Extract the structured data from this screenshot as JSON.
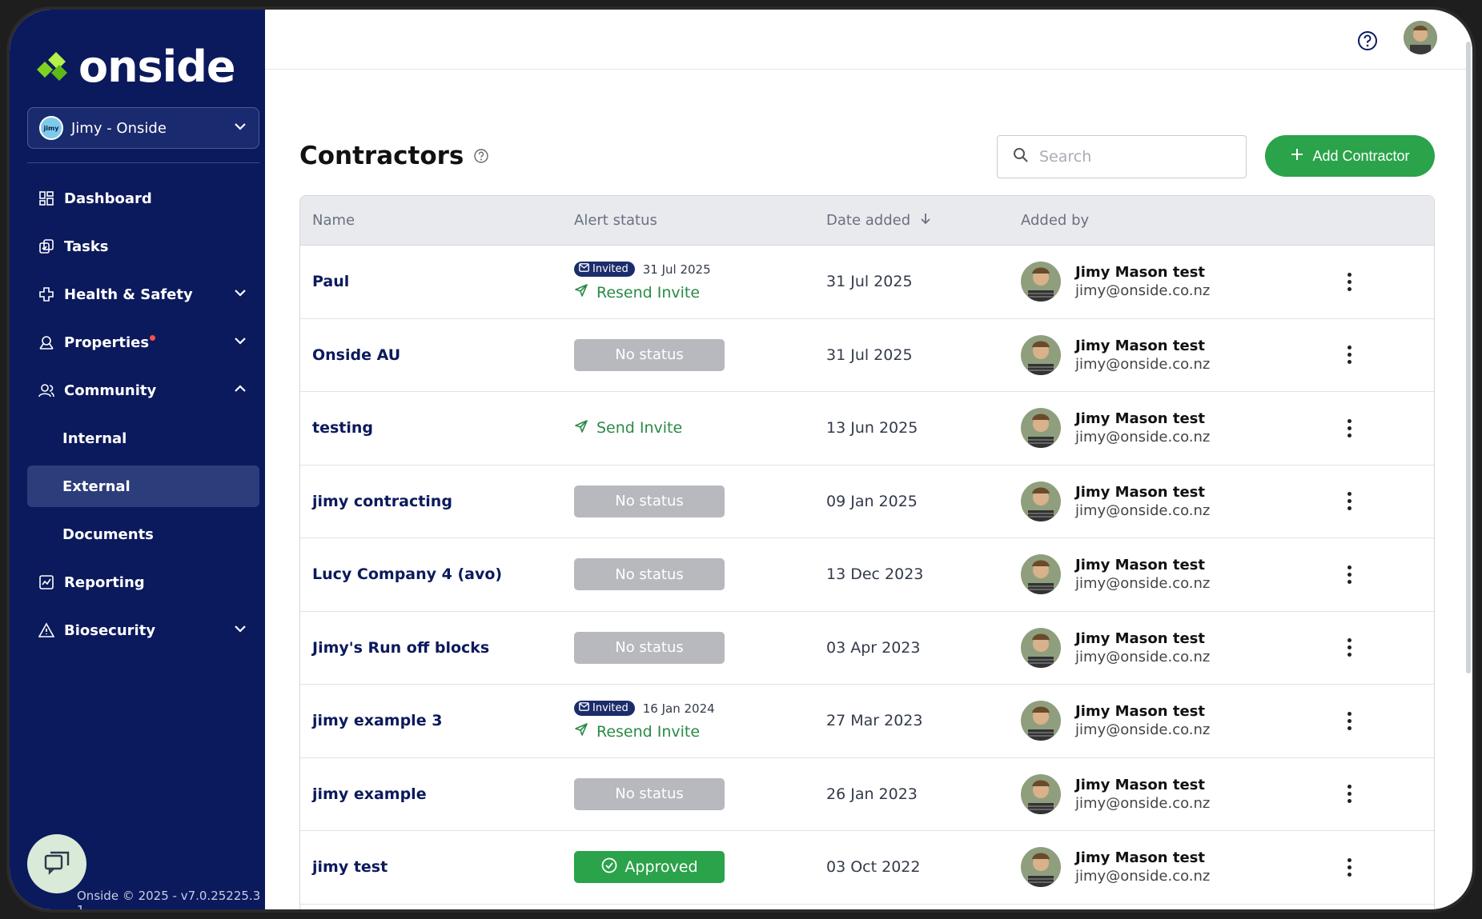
{
  "brand": {
    "name": "onside",
    "accent": "#7ed321"
  },
  "org_selector": {
    "label": "Jimy - Onside"
  },
  "nav": {
    "dashboard": "Dashboard",
    "tasks": "Tasks",
    "health_safety": "Health & Safety",
    "properties": "Properties",
    "community": "Community",
    "internal": "Internal",
    "external": "External",
    "documents": "Documents",
    "reporting": "Reporting",
    "biosecurity": "Biosecurity"
  },
  "footer": {
    "version": "Onside © 2025 - v7.0.25225.3 1"
  },
  "page": {
    "title": "Contractors"
  },
  "search": {
    "placeholder": "Search"
  },
  "actions": {
    "add_contractor": "Add Contractor"
  },
  "table": {
    "columns": {
      "name": "Name",
      "alert_status": "Alert status",
      "date_added": "Date added",
      "added_by": "Added by"
    },
    "rows": [
      {
        "name": "Paul",
        "status_type": "invited",
        "invited_label": "Invited",
        "invited_date": "31 Jul 2025",
        "action": "Resend Invite",
        "date": "31 Jul 2025",
        "by_name": "Jimy Mason test",
        "by_email": "jimy@onside.co.nz"
      },
      {
        "name": "Onside AU",
        "status_type": "none",
        "status": "No status",
        "date": "31 Jul 2025",
        "by_name": "Jimy Mason test",
        "by_email": "jimy@onside.co.nz"
      },
      {
        "name": "testing",
        "status_type": "send",
        "action": "Send Invite",
        "date": "13 Jun 2025",
        "by_name": "Jimy Mason test",
        "by_email": "jimy@onside.co.nz"
      },
      {
        "name": "jimy contracting",
        "status_type": "none",
        "status": "No status",
        "date": "09 Jan 2025",
        "by_name": "Jimy Mason test",
        "by_email": "jimy@onside.co.nz"
      },
      {
        "name": "Lucy Company 4 (avo)",
        "status_type": "none",
        "status": "No status",
        "date": "13 Dec 2023",
        "by_name": "Jimy Mason test",
        "by_email": "jimy@onside.co.nz"
      },
      {
        "name": "Jimy's Run off blocks",
        "status_type": "none",
        "status": "No status",
        "date": "03 Apr 2023",
        "by_name": "Jimy Mason test",
        "by_email": "jimy@onside.co.nz"
      },
      {
        "name": "jimy example 3",
        "status_type": "invited",
        "invited_label": "Invited",
        "invited_date": "16 Jan 2024",
        "action": "Resend Invite",
        "date": "27 Mar 2023",
        "by_name": "Jimy Mason test",
        "by_email": "jimy@onside.co.nz"
      },
      {
        "name": "jimy example",
        "status_type": "none",
        "status": "No status",
        "date": "26 Jan 2023",
        "by_name": "Jimy Mason test",
        "by_email": "jimy@onside.co.nz"
      },
      {
        "name": "jimy test",
        "status_type": "approved",
        "status": "Approved",
        "date": "03 Oct 2022",
        "by_name": "Jimy Mason test",
        "by_email": "jimy@onside.co.nz"
      }
    ]
  }
}
